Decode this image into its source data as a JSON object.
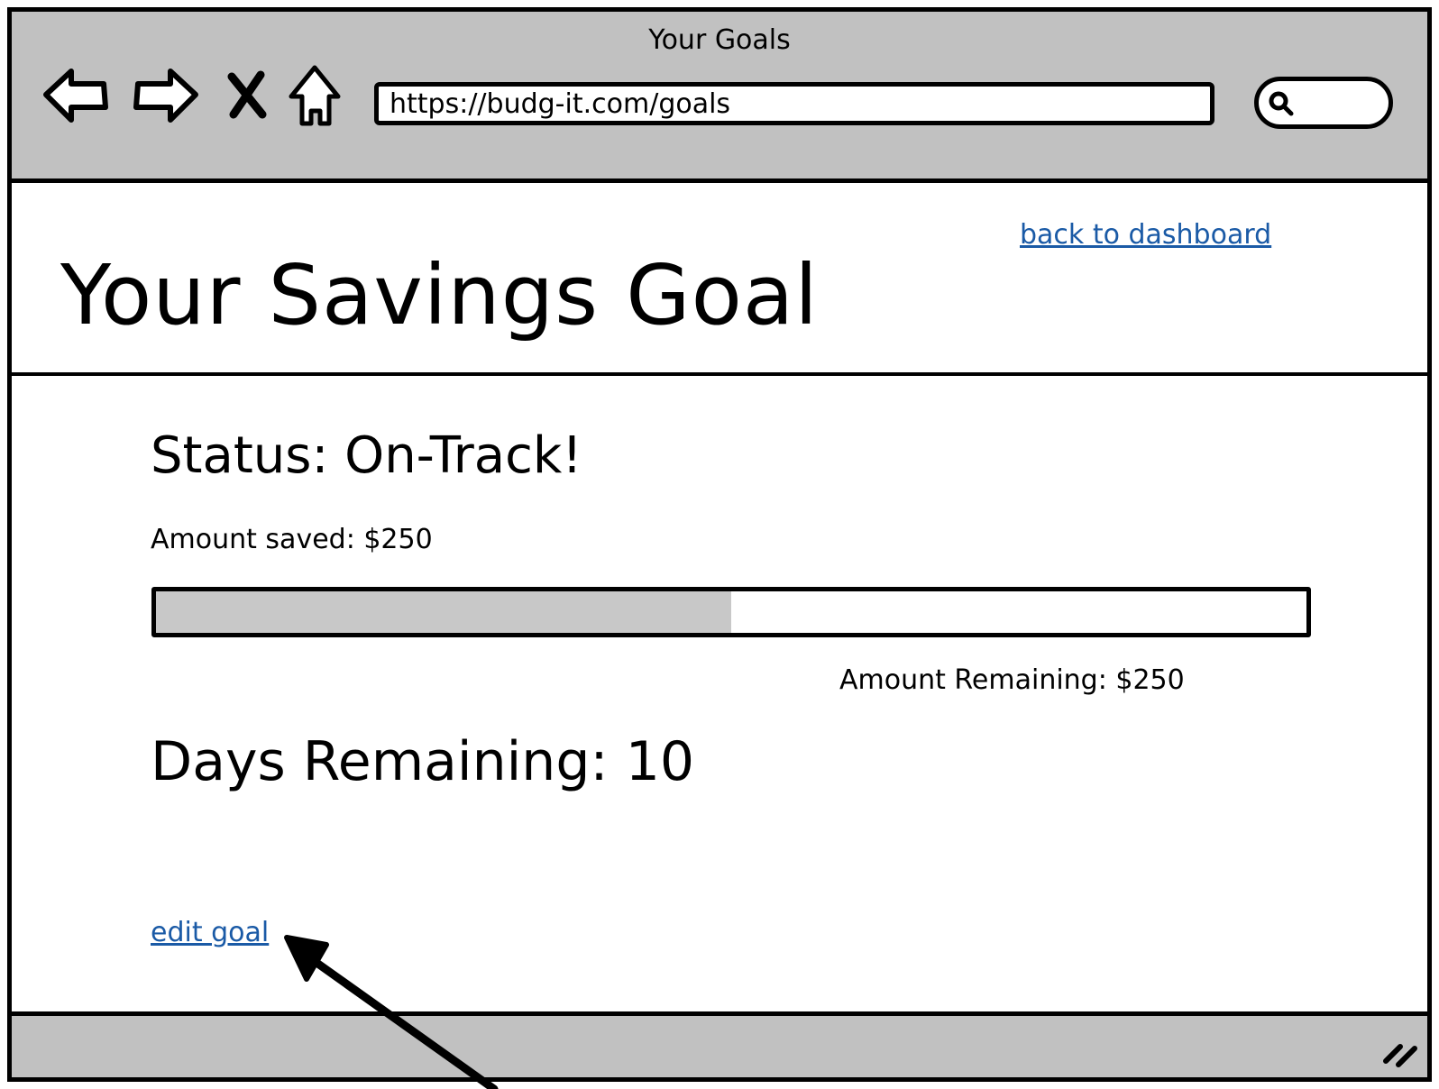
{
  "window": {
    "title": "Your Goals"
  },
  "toolbar": {
    "url": "https://budg-it.com/goals",
    "icons": [
      "back-arrow-icon",
      "forward-arrow-icon",
      "stop-icon",
      "home-icon",
      "search-icon"
    ]
  },
  "page": {
    "back_link": "back to dashboard",
    "title": "Your Savings Goal",
    "status": "Status: On-Track!",
    "amount_saved": "Amount saved: $250",
    "progress": 0.5,
    "amount_remaining": "Amount Remaining: $250",
    "days_remaining": "Days Remaining: 10",
    "edit_link": "edit goal"
  },
  "colors": {
    "chrome": "#c1c1c1",
    "link": "#1a5aa6",
    "progress_fill": "#c8c8c8"
  }
}
